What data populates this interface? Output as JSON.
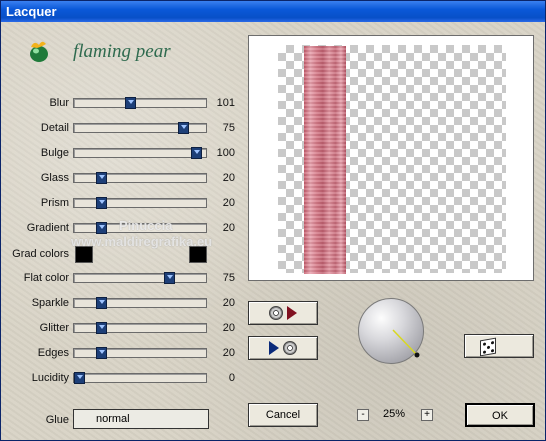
{
  "window": {
    "title": "Lacquer"
  },
  "brand": {
    "name": "flaming pear",
    "logo_icon": "flaming-pear-logo-icon"
  },
  "watermark": {
    "line1": "Pinuccia",
    "line2": "www.maldiregrafika.eu"
  },
  "sliders": [
    {
      "label": "Blur",
      "value": "101",
      "level": 0.42
    },
    {
      "label": "Detail",
      "value": "75",
      "level": 0.86
    },
    {
      "label": "Bulge",
      "value": "100",
      "level": 0.97
    },
    {
      "label": "Glass",
      "value": "20",
      "level": 0.18
    },
    {
      "label": "Prism",
      "value": "20",
      "level": 0.18
    },
    {
      "label": "Gradient",
      "value": "20",
      "level": 0.18
    },
    {
      "label": "Flat color",
      "value": "75",
      "level": 0.74
    },
    {
      "label": "Sparkle",
      "value": "20",
      "level": 0.18
    },
    {
      "label": "Glitter",
      "value": "20",
      "level": 0.18
    },
    {
      "label": "Edges",
      "value": "20",
      "level": 0.18
    },
    {
      "label": "Lucidity",
      "value": "0",
      "level": 0.0
    }
  ],
  "grad_colors": {
    "label": "Grad colors",
    "color1": "#000000",
    "color2": "#000000"
  },
  "glue": {
    "label": "Glue",
    "value": "normal"
  },
  "zoom": {
    "minus": "-",
    "value": "25%",
    "plus": "+"
  },
  "buttons": {
    "cancel": "Cancel",
    "ok": "OK"
  },
  "icons": {
    "load_settings": [
      "cd-icon",
      "arrow-right-icon"
    ],
    "save_settings": [
      "arrow-right-icon",
      "cd-icon"
    ],
    "randomize": "dice-icon",
    "light_dial": "light-direction-dial"
  },
  "colors": {
    "titlebar": "#0a58d8",
    "slider_thumb": "#1d3f78",
    "brand_text": "#2e6a4e",
    "strip": "#d67a88"
  }
}
